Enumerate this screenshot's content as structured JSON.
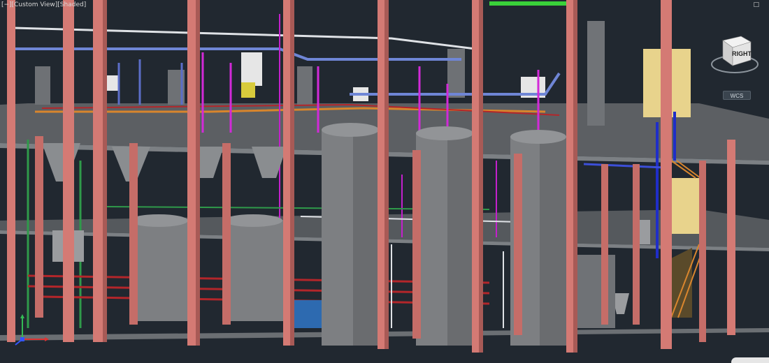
{
  "viewport": {
    "view_label": "[−][Custom View][Shaded]",
    "window_control": "□"
  },
  "navigation": {
    "viewcube_face": "RIGHT",
    "coordinate_system": "WCS"
  },
  "colors": {
    "background": "#212830",
    "column": "#d47a74",
    "column_shadow": "#a85a56",
    "floor": "#5c5f63",
    "floor_edge": "#7c8084",
    "tank": "#7d7f82",
    "pipe_blue": "#6f86d6",
    "pipe_magenta": "#d22ad8",
    "pipe_red": "#b3262a",
    "pipe_green": "#2f9a4a",
    "pipe_orange": "#d8852c",
    "pipe_white": "#dfe2e6",
    "equipment_yellow": "#e8d38c",
    "stair_orange": "#d9862e"
  },
  "icons": {
    "viewcube": "viewcube-icon",
    "ucs": "ucs-axis-icon",
    "window": "window-restore-icon"
  }
}
